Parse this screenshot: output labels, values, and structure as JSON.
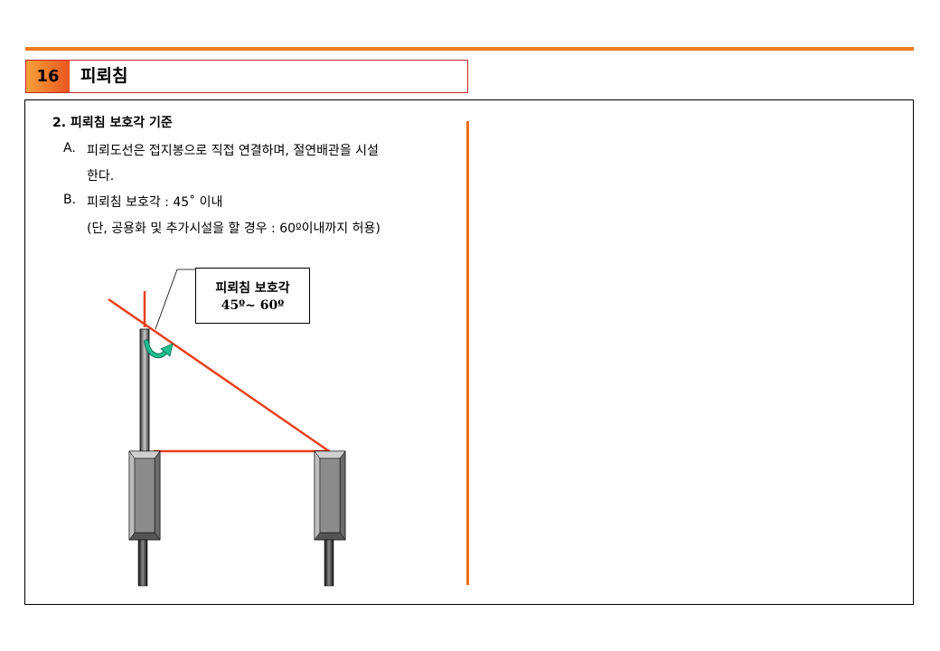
{
  "header": {
    "number": "16",
    "title": "피뢰침"
  },
  "section": {
    "heading": "2.  피뢰침 보호각 기준"
  },
  "items": [
    {
      "marker": "A.",
      "lines": [
        "피뢰도선은 접지봉으로 직접 연결하며, 절연배관을 시설",
        "한다."
      ]
    },
    {
      "marker": "B.",
      "lines": [
        "피뢰침 보호각 : 45˚ 이내",
        "(단, 공용화 및 추가시설을 할 경우 : 60º이내까지 허용)"
      ]
    }
  ],
  "diagram": {
    "callout_line1": "피뢰침  보호각",
    "callout_line2": "45º~ 60º",
    "icons": [
      "curved-arrow-icon"
    ]
  },
  "colors": {
    "accent_orange": "#f07a1e",
    "title_border": "#c0262b",
    "protection_line": "#e8401c",
    "arrow_green": "#1aa37a"
  }
}
